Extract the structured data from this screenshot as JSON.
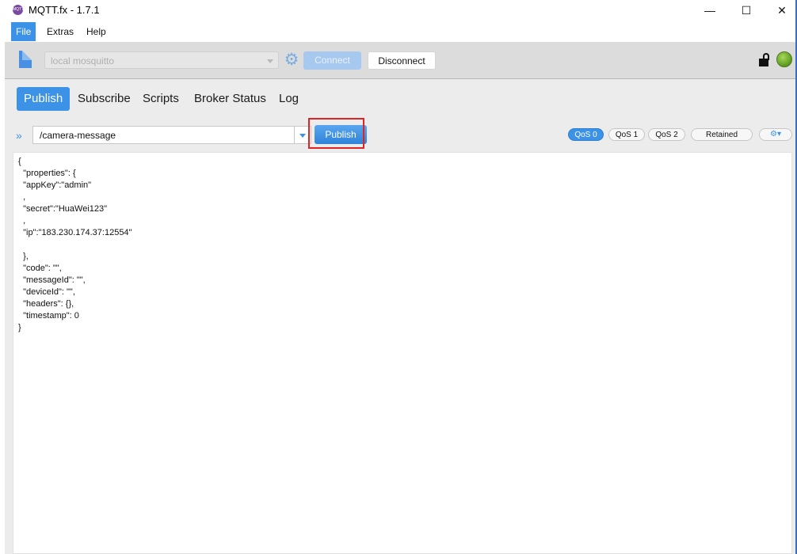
{
  "window": {
    "title": "MQTT.fx - 1.7.1",
    "app_icon_text": "MQTT",
    "minimize": "—",
    "maximize": "☐",
    "close": "✕"
  },
  "menu": [
    "File",
    "Extras",
    "Help"
  ],
  "toolbar": {
    "profile": "local mosquitto",
    "connect_label": "Connect",
    "disconnect_label": "Disconnect",
    "connected": true,
    "status_color": "#6cb02c"
  },
  "tabs": [
    "Publish",
    "Subscribe",
    "Scripts",
    "Broker Status",
    "Log"
  ],
  "publish": {
    "expand_icon": "»",
    "topic": "/camera-message",
    "publish_label": "Publish",
    "qos": [
      "QoS 0",
      "QoS 1",
      "QoS 2"
    ],
    "selected_qos": "QoS 0",
    "retained_label": "Retained",
    "settings_icon": "⚙▾",
    "payload": "{\n  \"properties\": {\n  \"appKey\":\"admin\"\n  ,\n  \"secret\":\"HuaWei123\"\n  ,\n  \"ip\":\"183.230.174.37:12554\"\n\n  },\n  \"code\": \"\",\n  \"messageId\": \"\",\n  \"deviceId\": \"\",\n  \"headers\": {},\n  \"timestamp\": 0\n}"
  },
  "colors": {
    "accent": "#3c92e6",
    "highlight_box": "#e02424"
  }
}
